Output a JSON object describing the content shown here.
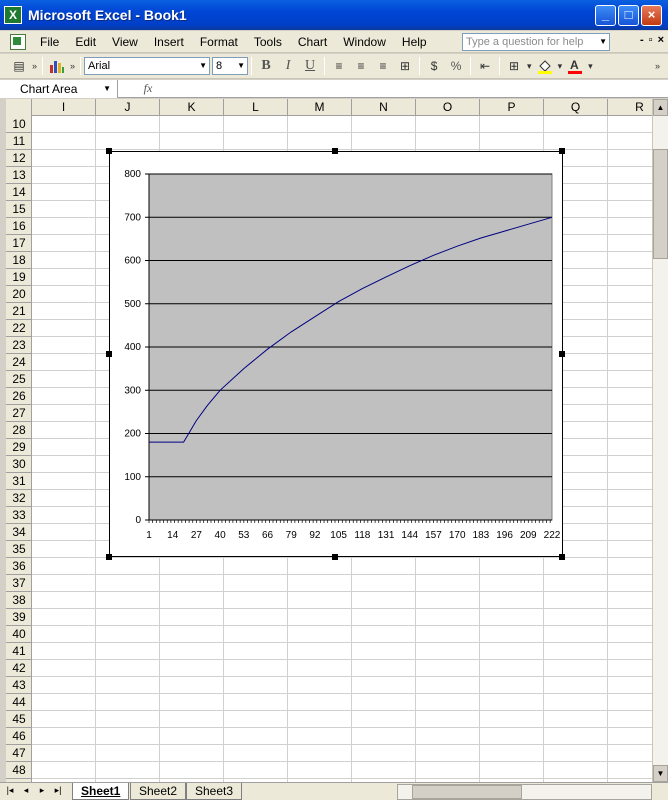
{
  "window": {
    "title": "Microsoft Excel - Book1",
    "minimize": "_",
    "maximize": "□",
    "close": "×"
  },
  "menubar": {
    "items": [
      "File",
      "Edit",
      "View",
      "Insert",
      "Format",
      "Tools",
      "Chart",
      "Window",
      "Help"
    ],
    "help_placeholder": "Type a question for help",
    "mdi": [
      "-",
      "▫",
      "×"
    ]
  },
  "toolbar": {
    "font": "Arial",
    "size": "8",
    "bold": "B",
    "italic": "I",
    "underline": "U",
    "percent": "%"
  },
  "formula_bar": {
    "name_box": "Chart Area",
    "fx": "fx",
    "value": ""
  },
  "columns": [
    "I",
    "J",
    "K",
    "L",
    "M",
    "N",
    "O",
    "P",
    "Q",
    "R"
  ],
  "rows": [
    "10",
    "11",
    "12",
    "13",
    "14",
    "15",
    "16",
    "17",
    "18",
    "19",
    "20",
    "21",
    "22",
    "23",
    "24",
    "25",
    "26",
    "27",
    "28",
    "29",
    "30",
    "31",
    "32",
    "33",
    "34",
    "35",
    "36",
    "37",
    "38",
    "39",
    "40",
    "41",
    "42",
    "43",
    "44",
    "45",
    "46",
    "47",
    "48"
  ],
  "sheets": [
    "Sheet1",
    "Sheet2",
    "Sheet3"
  ],
  "active_sheet": "Sheet1",
  "chart_data": {
    "type": "line",
    "title": "",
    "xlabel": "",
    "ylabel": "",
    "ylim": [
      0,
      800
    ],
    "y_ticks": [
      0,
      100,
      200,
      300,
      400,
      500,
      600,
      700,
      800
    ],
    "x_tick_labels": [
      "1",
      "14",
      "27",
      "40",
      "53",
      "66",
      "79",
      "92",
      "105",
      "118",
      "131",
      "144",
      "157",
      "170",
      "183",
      "196",
      "209",
      "222"
    ],
    "xlim": [
      1,
      222
    ],
    "grid": true,
    "legend": "none",
    "plot_background": "#c0c0c0",
    "line_color": "#000080",
    "series": [
      {
        "x": [
          1,
          14,
          20,
          27,
          33,
          40,
          53,
          66,
          79,
          92,
          105,
          118,
          131,
          144,
          157,
          170,
          183,
          196,
          209,
          222
        ],
        "values": [
          180,
          180,
          180,
          230,
          265,
          300,
          350,
          395,
          435,
          470,
          505,
          535,
          562,
          588,
          612,
          633,
          652,
          668,
          684,
          700
        ]
      }
    ]
  }
}
